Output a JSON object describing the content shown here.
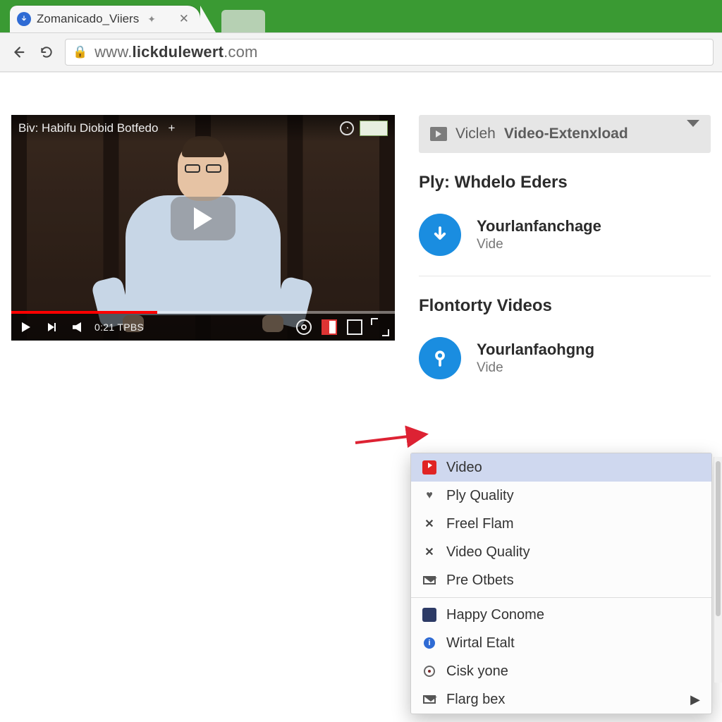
{
  "browser": {
    "tab_title": "Zomanicado_Viiers",
    "url_muted_prefix": "www.",
    "url_bold": "lickdulewert",
    "url_muted_suffix": ".com"
  },
  "video": {
    "overlay_title": "Biv: Habifu Diobid Botfedo",
    "time": "0:21 TPBS"
  },
  "panel": {
    "header_light": "Vicleh",
    "header_bold": "Video-Extenxload",
    "section1_title": "Ply: Whdelo Eders",
    "section2_title": "Flontorty Videos",
    "items": [
      {
        "title": "Yourlanfanchage",
        "sub": "Vide"
      },
      {
        "title": "Yourlanfaohgng",
        "sub": "Vide"
      }
    ]
  },
  "context_menu": {
    "items": [
      {
        "icon": "youtube-icon",
        "label": "Video"
      },
      {
        "icon": "heart-icon",
        "label": "Ply Quality"
      },
      {
        "icon": "x-icon",
        "label": "Freel Flam"
      },
      {
        "icon": "x-icon",
        "label": "Video Quality"
      },
      {
        "icon": "mail-icon",
        "label": "Pre Otbets"
      }
    ],
    "group2": [
      {
        "icon": "dashboard-icon",
        "label": "Happy Conome"
      },
      {
        "icon": "info-icon",
        "label": "Wirtal Etalt"
      },
      {
        "icon": "eye-icon",
        "label": "Cisk yone"
      },
      {
        "icon": "mail-icon",
        "label": "Flarg bex",
        "submenu": true
      }
    ]
  }
}
